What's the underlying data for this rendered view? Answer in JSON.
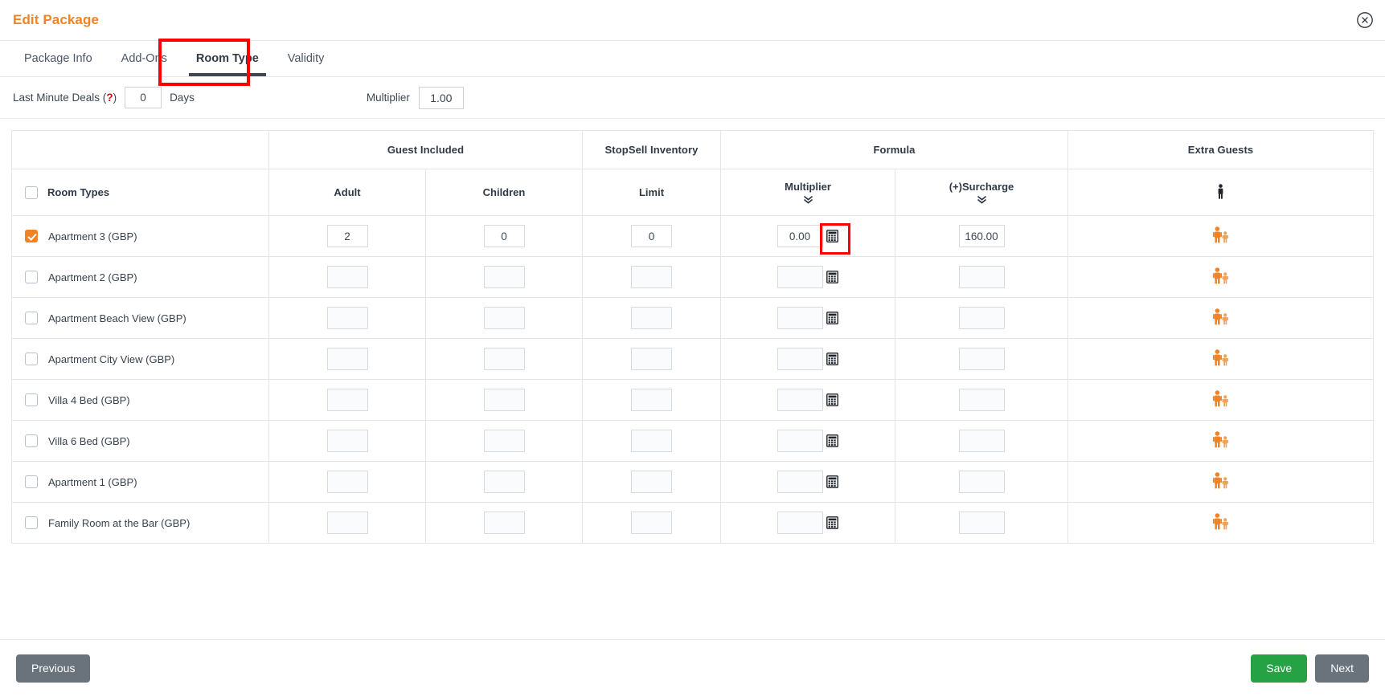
{
  "header": {
    "title": "Edit Package",
    "close_icon": "close-circle-icon"
  },
  "tabs": [
    {
      "label": "Package Info",
      "active": false
    },
    {
      "label": "Add-Ons",
      "active": false
    },
    {
      "label": "Room Type",
      "active": true
    },
    {
      "label": "Validity",
      "active": false
    }
  ],
  "last_minute": {
    "label_prefix": "Last Minute Deals (",
    "help_marker": "?",
    "label_suffix": ")",
    "days_value": "0",
    "days_unit": "Days",
    "multiplier_label": "Multiplier",
    "multiplier_value": "1.00"
  },
  "table": {
    "group_headers": {
      "room": "",
      "guest_included": "Guest Included",
      "stopsell": "StopSell Inventory",
      "formula": "Formula",
      "extra_guests": "Extra Guests"
    },
    "sub_headers": {
      "room_types": "Room Types",
      "adult": "Adult",
      "children": "Children",
      "limit": "Limit",
      "multiplier": "Multiplier",
      "surcharge": "(+)Surcharge",
      "extra_guests_icon": "person-icon"
    },
    "chevron_glyph": "»",
    "calculator_icon": "calculator-icon",
    "guest_icon": "adult-child-icon",
    "rows": [
      {
        "name": "Apartment 3 (GBP)",
        "checked": true,
        "adult": "2",
        "children": "0",
        "limit": "0",
        "multiplier": "0.00",
        "surcharge": "160.00",
        "calc_highlighted": true,
        "enabled": true
      },
      {
        "name": "Apartment 2 (GBP)",
        "checked": false,
        "adult": "",
        "children": "",
        "limit": "",
        "multiplier": "",
        "surcharge": "",
        "calc_highlighted": false,
        "enabled": false
      },
      {
        "name": "Apartment Beach View (GBP)",
        "checked": false,
        "adult": "",
        "children": "",
        "limit": "",
        "multiplier": "",
        "surcharge": "",
        "calc_highlighted": false,
        "enabled": false
      },
      {
        "name": "Apartment City View (GBP)",
        "checked": false,
        "adult": "",
        "children": "",
        "limit": "",
        "multiplier": "",
        "surcharge": "",
        "calc_highlighted": false,
        "enabled": false
      },
      {
        "name": "Villa 4 Bed (GBP)",
        "checked": false,
        "adult": "",
        "children": "",
        "limit": "",
        "multiplier": "",
        "surcharge": "",
        "calc_highlighted": false,
        "enabled": false
      },
      {
        "name": "Villa 6 Bed (GBP)",
        "checked": false,
        "adult": "",
        "children": "",
        "limit": "",
        "multiplier": "",
        "surcharge": "",
        "calc_highlighted": false,
        "enabled": false
      },
      {
        "name": "Apartment 1 (GBP)",
        "checked": false,
        "adult": "",
        "children": "",
        "limit": "",
        "multiplier": "",
        "surcharge": "",
        "calc_highlighted": false,
        "enabled": false
      },
      {
        "name": "Family Room at the Bar (GBP)",
        "checked": false,
        "adult": "",
        "children": "",
        "limit": "",
        "multiplier": "",
        "surcharge": "",
        "calc_highlighted": false,
        "enabled": false
      }
    ]
  },
  "footer": {
    "previous": "Previous",
    "save": "Save",
    "next": "Next"
  },
  "colors": {
    "accent_orange": "#f08326",
    "highlight_red": "#fe0000",
    "save_green": "#25a244",
    "grey_button": "#6a737c"
  }
}
